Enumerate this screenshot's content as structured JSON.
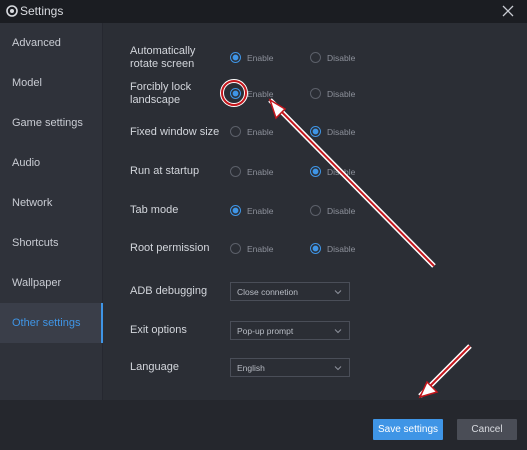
{
  "window": {
    "title": "Settings"
  },
  "sidebar": {
    "items": [
      {
        "label": "Advanced"
      },
      {
        "label": "Model"
      },
      {
        "label": "Game settings"
      },
      {
        "label": "Audio"
      },
      {
        "label": "Network"
      },
      {
        "label": "Shortcuts"
      },
      {
        "label": "Wallpaper"
      },
      {
        "label": "Other settings",
        "active": true
      }
    ]
  },
  "settings": {
    "radio_options": {
      "enable": "Enable",
      "disable": "Disable"
    },
    "rows": [
      {
        "label": "Automatically rotate screen",
        "value": "Enable"
      },
      {
        "label": "Forcibly lock landscape",
        "value": "Enable"
      },
      {
        "label": "Fixed window size",
        "value": "Disable"
      },
      {
        "label": "Run at startup",
        "value": "Disable"
      },
      {
        "label": "Tab mode",
        "value": "Enable"
      },
      {
        "label": "Root permission",
        "value": "Disable"
      }
    ],
    "dropdowns": [
      {
        "label": "ADB debugging",
        "value": "Close connetion"
      },
      {
        "label": "Exit options",
        "value": "Pop-up prompt"
      },
      {
        "label": "Language",
        "value": "English"
      }
    ]
  },
  "footer": {
    "save_label": "Save settings",
    "cancel_label": "Cancel"
  },
  "colors": {
    "accent": "#3f95e6",
    "annotation": "#c4161c",
    "background": "#2b2e35"
  },
  "icons": {
    "title": "gear-icon",
    "close": "close-icon",
    "dropdown": "chevron-down-icon"
  }
}
